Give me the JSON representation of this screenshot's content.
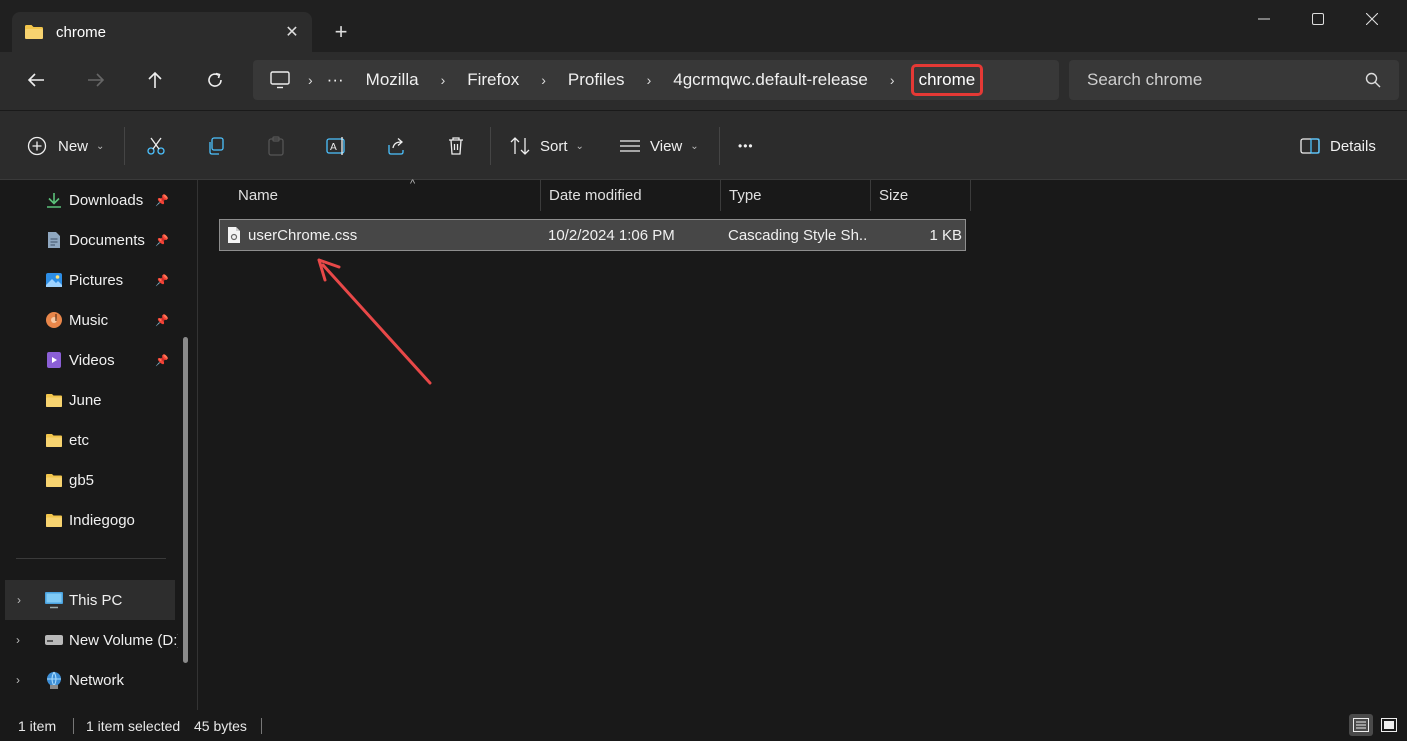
{
  "window": {
    "tab_title": "chrome",
    "tab_close": "✕",
    "new_tab": "+"
  },
  "address": {
    "overflow": "···",
    "crumbs": [
      "Mozilla",
      "Firefox",
      "Profiles",
      "4gcrmqwc.default-release"
    ],
    "current": "chrome"
  },
  "search": {
    "placeholder": "Search chrome"
  },
  "toolbar": {
    "new_label": "New",
    "sort_label": "Sort",
    "view_label": "View",
    "more_label": "•••",
    "details_label": "Details"
  },
  "sidebar": {
    "quick": [
      {
        "label": "Downloads",
        "icon": "download-icon",
        "pinned": true
      },
      {
        "label": "Documents",
        "icon": "document-icon",
        "pinned": true
      },
      {
        "label": "Pictures",
        "icon": "pictures-icon",
        "pinned": true
      },
      {
        "label": "Music",
        "icon": "music-icon",
        "pinned": true
      },
      {
        "label": "Videos",
        "icon": "videos-icon",
        "pinned": true
      },
      {
        "label": "June",
        "icon": "folder-icon",
        "pinned": false
      },
      {
        "label": "etc",
        "icon": "folder-icon",
        "pinned": false
      },
      {
        "label": "gb5",
        "icon": "folder-icon",
        "pinned": false
      },
      {
        "label": "Indiegogo",
        "icon": "folder-icon",
        "pinned": false
      }
    ],
    "drives": [
      {
        "label": "This PC",
        "icon": "pc-icon",
        "selected": true
      },
      {
        "label": "New Volume (D:)",
        "icon": "drive-icon",
        "selected": false
      },
      {
        "label": "Network",
        "icon": "network-icon",
        "selected": false
      }
    ]
  },
  "table": {
    "columns": [
      "Name",
      "Date modified",
      "Type",
      "Size"
    ],
    "rows": [
      {
        "name": "userChrome.css",
        "date": "10/2/2024 1:06 PM",
        "type": "Cascading Style Sh...",
        "size": "1 KB"
      }
    ]
  },
  "status": {
    "count": "1 item",
    "selected": "1 item selected",
    "size": "45 bytes"
  },
  "colors": {
    "highlight": "#e53935",
    "folder": "#f2c54b",
    "annotation_arrow": "#e84848"
  }
}
